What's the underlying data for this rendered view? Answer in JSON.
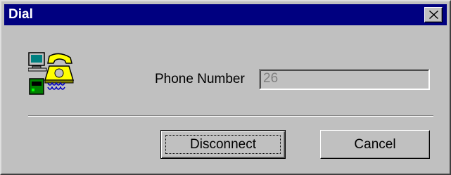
{
  "window": {
    "title": "Dial"
  },
  "form": {
    "phone_label": "Phone Number",
    "phone_value": "26"
  },
  "buttons": {
    "disconnect_label": "Disconnect",
    "cancel_label": "Cancel"
  },
  "icons": {
    "close": "close-icon",
    "app": "computer-phone-icon"
  },
  "colors": {
    "titlebar": "#000080",
    "face": "#c0c0c0",
    "title_text": "#ffffff"
  }
}
